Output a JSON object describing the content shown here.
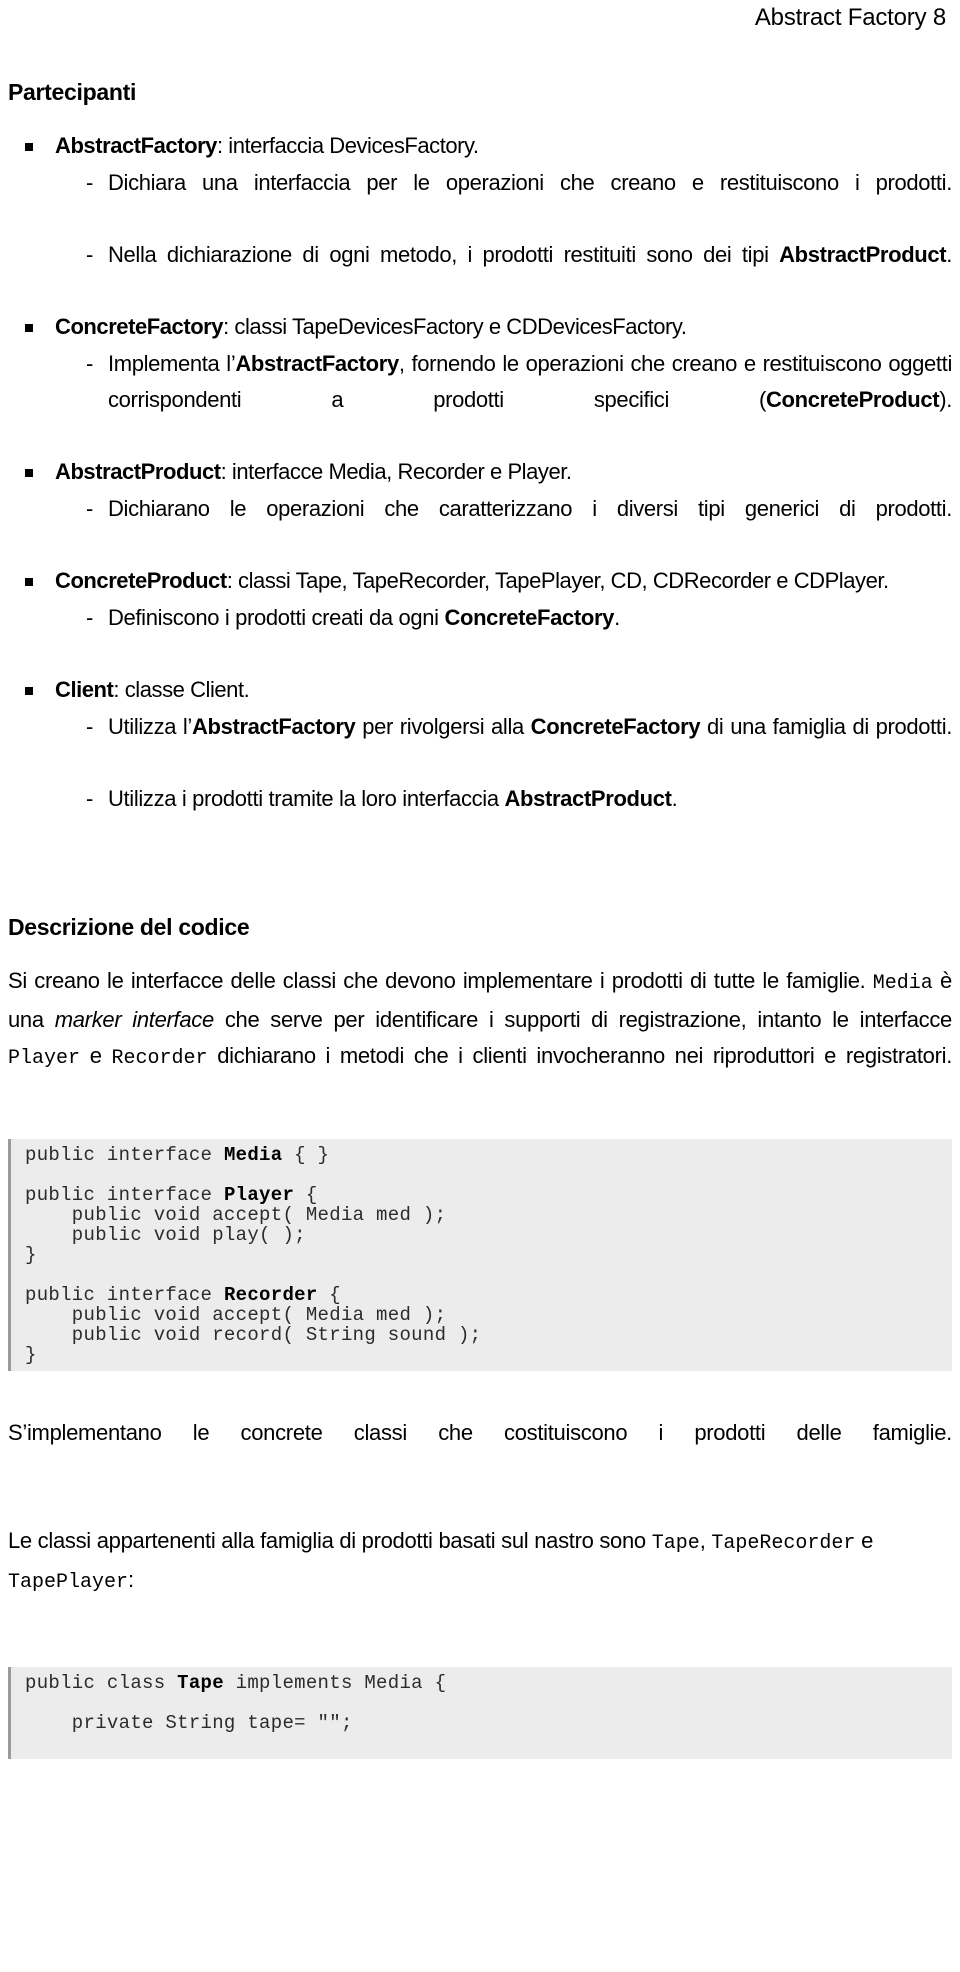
{
  "header": {
    "running_title": "Abstract Factory 8"
  },
  "sections": {
    "participants": {
      "heading": "Partecipanti",
      "items": [
        {
          "term": "AbstractFactory",
          "rest": ": interfaccia DevicesFactory.",
          "sub": [
            "Dichiara una interfaccia per le operazioni che creano e restituiscono i prodotti.",
            "Nella dichiarazione di ogni metodo, i prodotti restituiti sono dei tipi AbstractProduct."
          ]
        },
        {
          "term": "ConcreteFactory",
          "rest": ": classi TapeDevicesFactory e CDDevicesFactory.",
          "sub": [
            "Implementa l’AbstractFactory, fornendo le operazioni che creano e restituiscono oggetti corrispondenti a prodotti specifici (ConcreteProduct)."
          ]
        },
        {
          "term": "AbstractProduct",
          "rest": ": interfacce Media, Recorder e Player.",
          "sub": [
            "Dichiarano le operazioni che caratterizzano i diversi tipi generici di prodotti."
          ]
        },
        {
          "term": "ConcreteProduct",
          "rest": ": classi Tape, TapeRecorder, TapePlayer, CD, CDRecorder e CDPlayer.",
          "sub": [
            "Definiscono i prodotti creati da ogni ConcreteFactory."
          ]
        },
        {
          "term": "Client",
          "rest": ": classe Client.",
          "sub": [
            "Utilizza l’AbstractFactory per rivolgersi alla ConcreteFactory di una famiglia di prodotti.",
            "Utilizza i prodotti tramite la loro interfaccia AbstractProduct."
          ]
        }
      ]
    },
    "code_description": {
      "heading": "Descrizione del codice",
      "paragraph_1_parts": {
        "a": "Si creano le interfacce delle classi che devono implementare i prodotti di tutte le famiglie. ",
        "code_1": "Media",
        "b": " è una ",
        "italic_1": "marker interface",
        "c": " che serve per identificare i supporti di registrazione, intanto le interfacce ",
        "code_2": "Player",
        "d": " e ",
        "code_3": "Recorder",
        "e": " dichiarano i metodi che i clienti invocheranno nei riproduttori e registratori."
      },
      "code_block_1": {
        "lines": [
          "public interface Media { }",
          "",
          "public interface Player {",
          "    public void accept( Media med );",
          "    public void play( );",
          "}",
          "",
          "public interface Recorder {",
          "    public void accept( Media med );",
          "    public void record( String sound );",
          "}"
        ],
        "bold_tokens": [
          "Media",
          "Player",
          "Recorder"
        ]
      },
      "paragraph_2": "S’implementano le concrete classi che costituiscono i prodotti delle famiglie.",
      "paragraph_3_parts": {
        "a": "Le classi appartenenti alla famiglia di prodotti basati sul nastro sono ",
        "code_1": "Tape",
        "b": ", ",
        "code_2": "TapeRecorder",
        "c": " e ",
        "code_3": "TapePlayer",
        "d": ":"
      },
      "code_block_2": {
        "lines": [
          "public class Tape implements Media {",
          "",
          "    private String tape= \"\";",
          "",
          ""
        ],
        "bold_tokens": [
          "Tape"
        ]
      }
    }
  },
  "colors": {
    "page_background": "#ffffff",
    "text": "#000000",
    "code_background": "#ececec",
    "code_text": "#2b2b2b",
    "code_border": "#9a9a9a"
  }
}
